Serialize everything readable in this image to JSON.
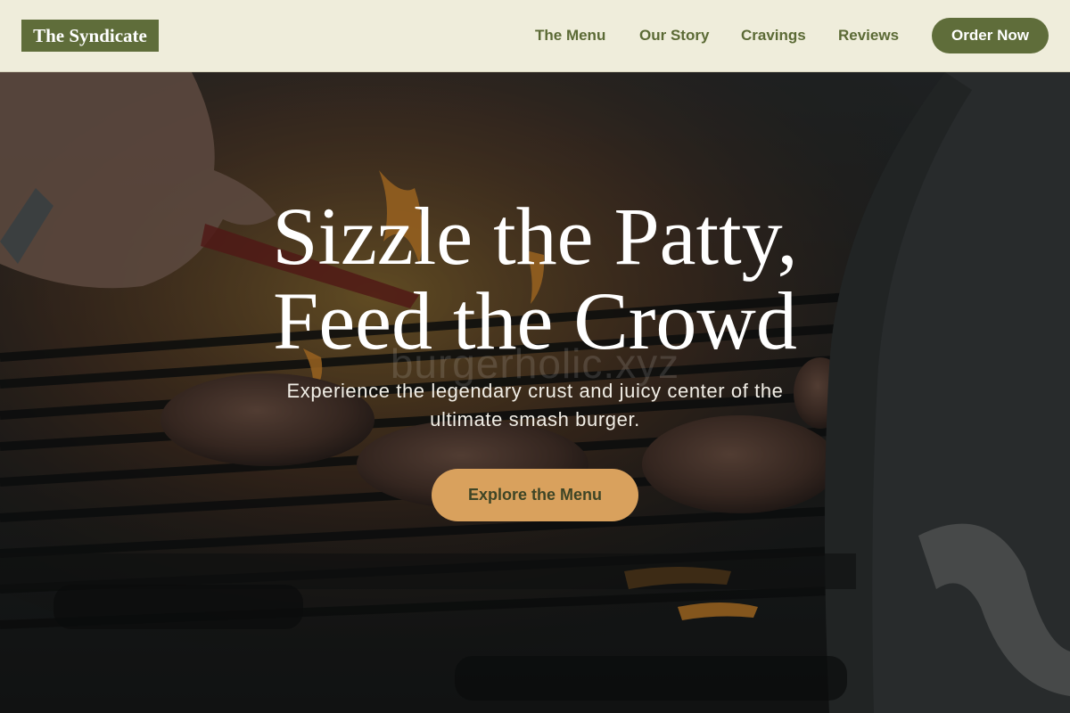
{
  "header": {
    "logo": "The Syndicate",
    "nav": [
      "The Menu",
      "Our Story",
      "Cravings",
      "Reviews"
    ],
    "order_button": "Order Now"
  },
  "hero": {
    "title_lines": [
      "Sizzle the Patty,",
      "Feed the Crowd"
    ],
    "subtitle_lines": [
      "Experience the legendary crust and juicy center of the",
      "ultimate smash burger."
    ],
    "cta": "Explore the Menu",
    "watermark": "burgerholic.xyz"
  },
  "colors": {
    "header_bg": "#efeddb",
    "brand_olive": "#5f6d3a",
    "cta_orange": "#d9a15d",
    "hero_text": "#ffffff"
  }
}
